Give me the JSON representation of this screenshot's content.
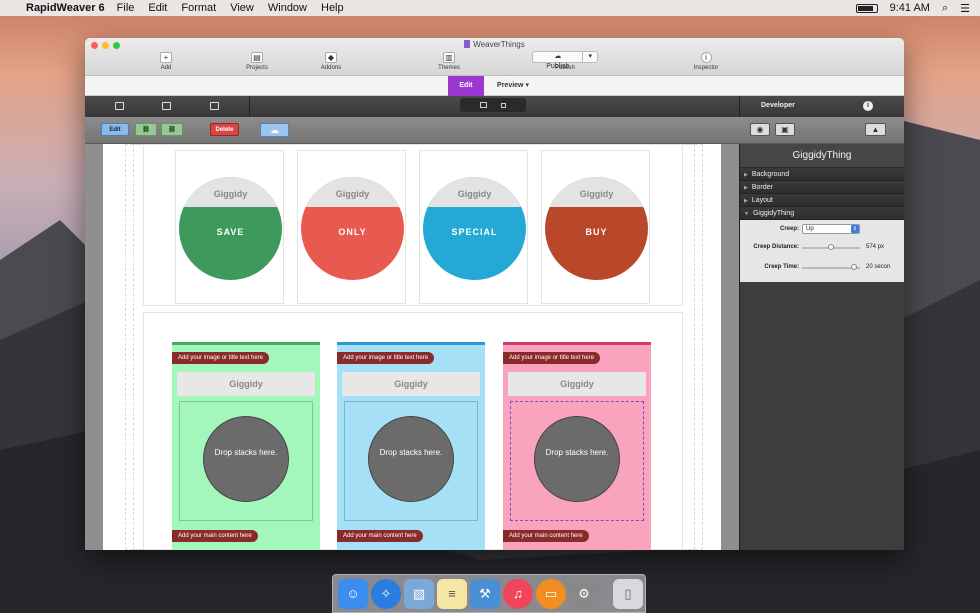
{
  "menubar": {
    "app": "RapidWeaver 6",
    "items": [
      "File",
      "Edit",
      "Format",
      "View",
      "Window",
      "Help"
    ],
    "time": "9:41 AM"
  },
  "window": {
    "title": "WeaverThings",
    "toolbar": {
      "add": "Add",
      "projects": "Projects",
      "addons": "Addons",
      "themes": "Themes",
      "publish_button": "Publish",
      "publish": "Publish",
      "inspector": "Inspector"
    }
  },
  "modes": {
    "edit": "Edit",
    "preview": "Preview"
  },
  "inspector": {
    "panel": "Developer",
    "title": "GiggidyThing",
    "sections": [
      "Background",
      "Border",
      "Layout",
      "GiggidyThing"
    ],
    "fields": {
      "creep_label": "Creep:",
      "creep_value": "Up",
      "distance_label": "Creep Distance:",
      "distance_value": "574 px",
      "distance_level": 0.5,
      "time_label": "Creep Time:",
      "time_value": "20 secon",
      "time_level": 0.95
    }
  },
  "actions": {
    "edit": "Edit",
    "delete": "Delete"
  },
  "circles": [
    {
      "top": "Giggidy",
      "label": "SAVE",
      "color": "#3d9a5c"
    },
    {
      "top": "Giggidy",
      "label": "ONLY",
      "color": "#e85a4f"
    },
    {
      "top": "Giggidy",
      "label": "SPECIAL",
      "color": "#24a9d6"
    },
    {
      "top": "Giggidy",
      "label": "BUY",
      "color": "#b9472a"
    }
  ],
  "tiles": [
    {
      "add_image": "Add your image or title text here",
      "title": "Giggidy",
      "drop": "Drop stacks here.",
      "add_main": "Add your main content here",
      "bg": "#a3f7bc",
      "accent": "#4aa85e"
    },
    {
      "add_image": "Add your image or title text here",
      "title": "Giggidy",
      "drop": "Drop stacks here.",
      "add_main": "Add your main content here",
      "bg": "#a6e0f7",
      "accent": "#2b9ad0"
    },
    {
      "add_image": "Add your image or title text here",
      "title": "Giggidy",
      "drop": "Drop stacks here.",
      "add_main": "Add your main content here",
      "bg": "#f9a3bd",
      "accent": "#d83a64"
    }
  ],
  "dock": [
    "finder-icon",
    "safari-icon",
    "preview-icon",
    "notes-icon",
    "xcode-icon",
    "itunes-icon",
    "ibooks-icon",
    "system-preferences-icon",
    "trash-icon"
  ]
}
